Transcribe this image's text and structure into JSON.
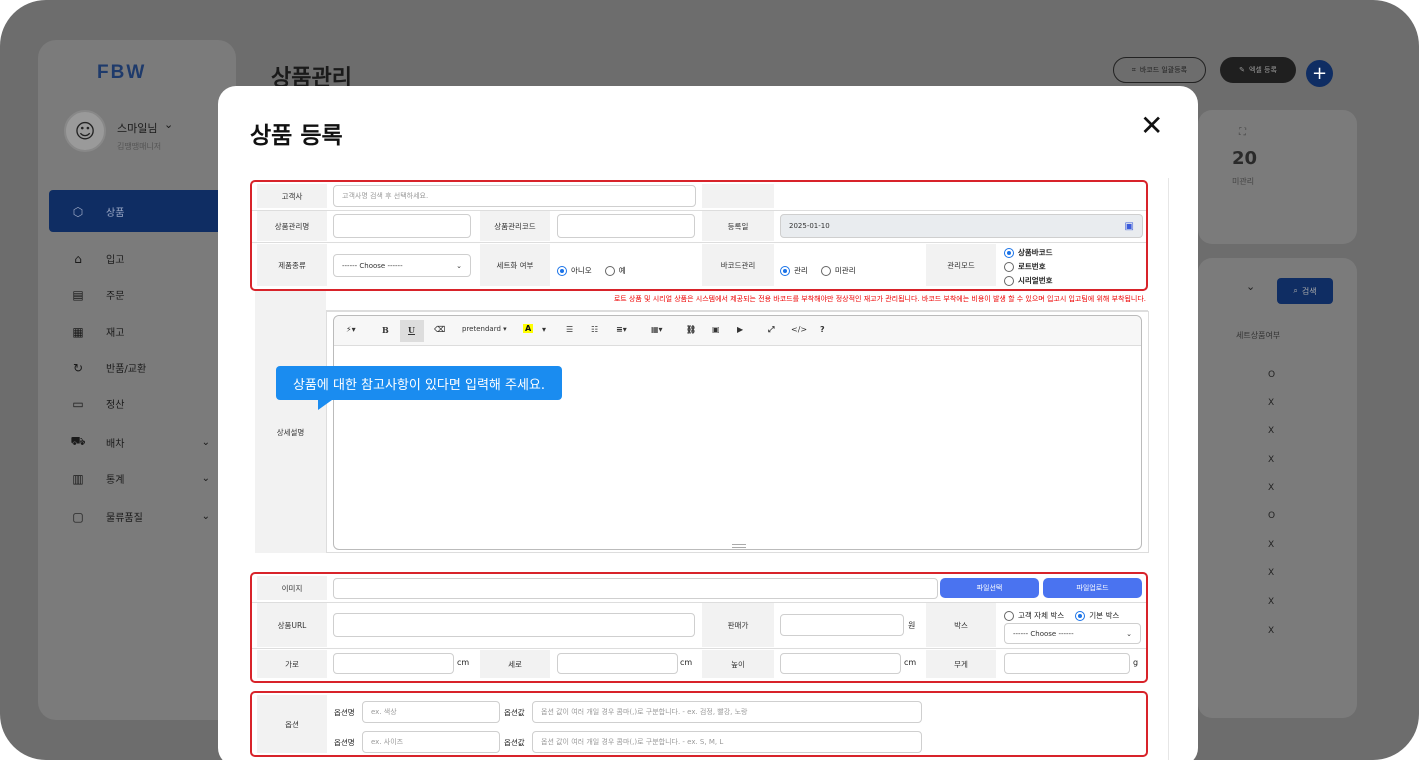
{
  "app": {
    "logo": "FBW",
    "page_title": "상품관리"
  },
  "user": {
    "name": "스마일님",
    "sub": "김땡땡매니저",
    "avatar": "☺"
  },
  "sidebar": {
    "items": [
      {
        "label": "상품",
        "icon": "cube-icon",
        "glyph": "⬡",
        "active": true
      },
      {
        "label": "입고",
        "icon": "home-icon",
        "glyph": "⌂"
      },
      {
        "label": "주문",
        "icon": "document-icon",
        "glyph": "▤"
      },
      {
        "label": "재고",
        "icon": "grid-icon",
        "glyph": "▦"
      },
      {
        "label": "반품/교환",
        "icon": "return-icon",
        "glyph": "↻"
      },
      {
        "label": "정산",
        "icon": "card-icon",
        "glyph": "▭"
      },
      {
        "label": "배차",
        "icon": "truck-icon",
        "glyph": "⛟"
      },
      {
        "label": "통계",
        "icon": "chart-icon",
        "glyph": "▥"
      },
      {
        "label": "물류품질",
        "icon": "chat-icon",
        "glyph": "▢"
      }
    ]
  },
  "header": {
    "barcode_btn": "바코드 일괄등록",
    "excel_btn": "엑셀 등록",
    "add_btn": "+"
  },
  "stats": {
    "count": "20",
    "label": "미관리"
  },
  "list": {
    "search_btn": "검색",
    "column": "세트상품여부",
    "values": [
      "O",
      "X",
      "X",
      "X",
      "X",
      "O",
      "X",
      "X",
      "X",
      "X"
    ]
  },
  "modal": {
    "title": "상품 등록",
    "close": "✕",
    "customer": {
      "label": "고객사",
      "placeholder": "고객사명 검색 후 선택하세요."
    },
    "product_name": {
      "label": "상품관리명"
    },
    "product_code": {
      "label": "상품관리코드"
    },
    "reg_date": {
      "label": "등록일",
      "value": "2025-01-10"
    },
    "category": {
      "label": "제품종류",
      "value": "------ Choose ------"
    },
    "set": {
      "label": "세트화 여부",
      "opt1": "아니오",
      "opt2": "예"
    },
    "barcode": {
      "label": "바코드관리",
      "opt1": "관리",
      "opt2": "미관리"
    },
    "mode": {
      "label": "관리모드",
      "opt1": "상품바코드",
      "opt2": "로트번호",
      "opt3": "시리얼번호"
    },
    "notice": "로트 상품 및 시리얼 상품은 시스템에서 제공되는 전용 바코드를 부착해야만 정상적인 재고가 관리됩니다. 바코드 부착에는 비용이 발생 할 수 있으며 입고시 입고팀에 위해 부착됩니다.",
    "detail": {
      "label": "상세설명",
      "font": "pretendard",
      "tooltip": "상품에 대한 참고사항이 있다면 입력해 주세요."
    },
    "image": {
      "label": "이미지",
      "select_btn": "파일선택",
      "upload_btn": "파일업로드"
    },
    "url": {
      "label": "상품URL"
    },
    "price": {
      "label": "판매가",
      "unit": "원"
    },
    "box": {
      "label": "박스",
      "opt1": "고객 자체 박스",
      "opt2": "기본 박스",
      "select": "------ Choose ------"
    },
    "width": {
      "label": "가로",
      "unit": "cm"
    },
    "depth": {
      "label": "세로",
      "unit": "cm"
    },
    "height": {
      "label": "높이",
      "unit": "cm"
    },
    "weight": {
      "label": "무게",
      "unit": "g"
    },
    "option": {
      "label": "옵션",
      "name_label": "옵션명",
      "value_label": "옵션값",
      "name1_ph": "ex. 색상",
      "value1_ph": "옵션 값이 여러 개일 경우 콤마(,)로 구분합니다. - ex. 검정, 빨강, 노랑",
      "name2_ph": "ex. 사이즈",
      "value2_ph": "옵션 값이 여러 개일 경우 콤마(,)로 구분합니다. - ex. S, M, L"
    }
  }
}
